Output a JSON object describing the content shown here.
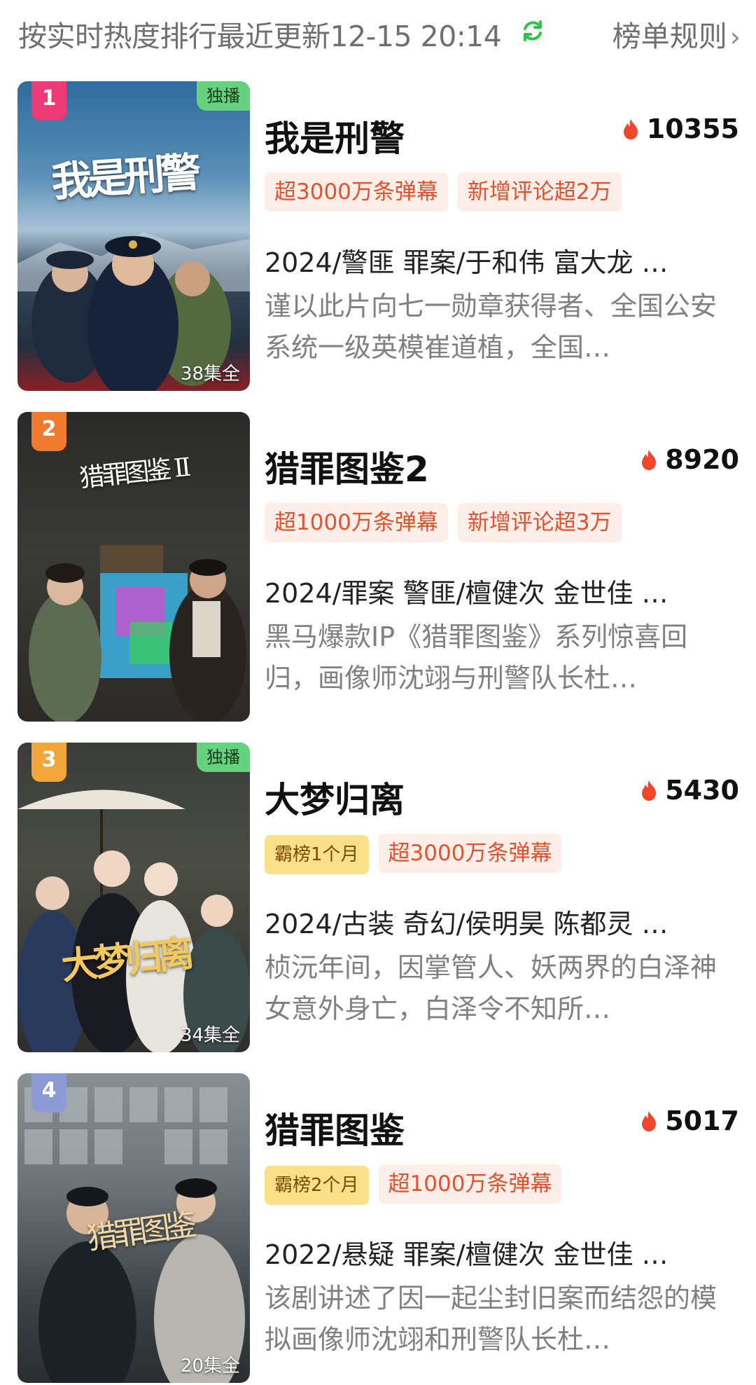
{
  "header": {
    "description": "按实时热度排行最近更新12-15 20:14",
    "rules_label": "榜单规则",
    "chevron": "›"
  },
  "items": [
    {
      "rank": "1",
      "rank_color": "#ec3a76",
      "exclusive": "独播",
      "episodes": "38集全",
      "poster_title": "我是刑警",
      "title": "我是刑警",
      "heat": "10355",
      "tags": [
        {
          "text": "超3000万条弹幕",
          "style": "orange"
        },
        {
          "text": "新增评论超2万",
          "style": "orange"
        }
      ],
      "meta": "2024/警匪 罪案/于和伟 富大龙 …",
      "synopsis": "谨以此片向七一勋章获得者、全国公安系统一级英模崔道植，全国…"
    },
    {
      "rank": "2",
      "rank_color": "#f07a2e",
      "exclusive": "",
      "episodes": "",
      "poster_title": "猎罪图鉴 II",
      "title": "猎罪图鉴2",
      "heat": "8920",
      "tags": [
        {
          "text": "超1000万条弹幕",
          "style": "orange"
        },
        {
          "text": "新增评论超3万",
          "style": "orange"
        }
      ],
      "meta": "2024/罪案 警匪/檀健次 金世佳 …",
      "synopsis": "黑马爆款IP《猎罪图鉴》系列惊喜回归，画像师沈翊与刑警队长杜…"
    },
    {
      "rank": "3",
      "rank_color": "#f2a53a",
      "exclusive": "独播",
      "episodes": "34集全",
      "poster_title": "大梦归离",
      "title": "大梦归离",
      "heat": "5430",
      "tags": [
        {
          "text": "霸榜1个月",
          "style": "gold"
        },
        {
          "text": "超3000万条弹幕",
          "style": "orange"
        }
      ],
      "meta": "2024/古装 奇幻/侯明昊 陈都灵 …",
      "synopsis": "桢沅年间，因掌管人、妖两界的白泽神女意外身亡，白泽令不知所…"
    },
    {
      "rank": "4",
      "rank_color": "#8c9ad6",
      "exclusive": "",
      "episodes": "20集全",
      "poster_title": "猎罪图鉴",
      "title": "猎罪图鉴",
      "heat": "5017",
      "tags": [
        {
          "text": "霸榜2个月",
          "style": "gold"
        },
        {
          "text": "超1000万条弹幕",
          "style": "orange"
        }
      ],
      "meta": "2022/悬疑 罪案/檀健次 金世佳 …",
      "synopsis": "该剧讲述了因一起尘封旧案而结怨的模拟画像师沈翊和刑警队长杜…"
    }
  ],
  "icons": {
    "refresh": "refresh-icon",
    "heat": "flame-icon"
  }
}
